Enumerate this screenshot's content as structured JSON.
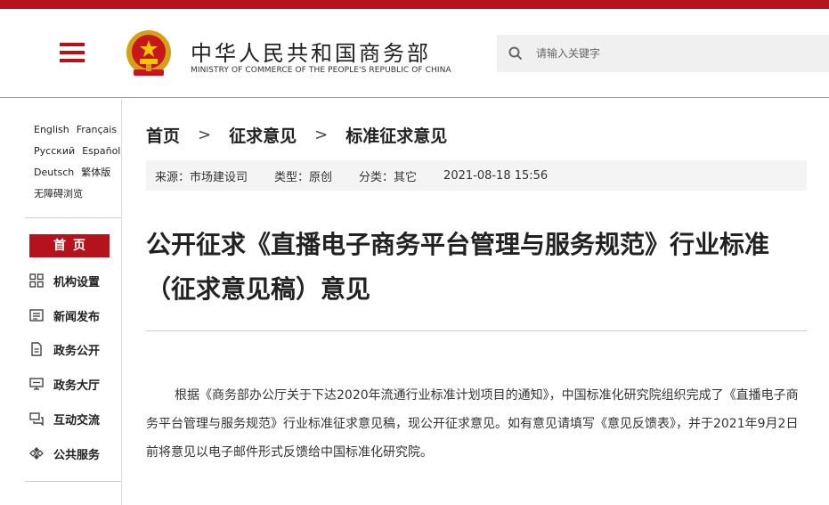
{
  "header": {
    "org_name_cn": "中华人民共和国商务部",
    "org_name_en": "MINISTRY OF COMMERCE OF THE PEOPLE'S REPUBLIC OF CHINA",
    "search_placeholder": "请输入关键字"
  },
  "sidebar": {
    "languages": [
      [
        "English",
        "Français"
      ],
      [
        "Русский",
        "Español"
      ],
      [
        "Deutsch",
        "繁体版"
      ],
      [
        "无障碍浏览"
      ]
    ],
    "home_label": "首页",
    "nav_items": [
      {
        "label": "机构设置",
        "icon": "grid-icon"
      },
      {
        "label": "新闻发布",
        "icon": "newspaper-icon"
      },
      {
        "label": "政务公开",
        "icon": "document-icon"
      },
      {
        "label": "政务大厅",
        "icon": "monitor-icon"
      },
      {
        "label": "互动交流",
        "icon": "chat-icon"
      },
      {
        "label": "公共服务",
        "icon": "service-icon"
      }
    ]
  },
  "breadcrumb": {
    "items": [
      "首页",
      "征求意见",
      "标准征求意见"
    ],
    "separator": ">"
  },
  "meta": {
    "source": "来源：市场建设司",
    "type": "类型：原创",
    "category": "分类：其它",
    "datetime": "2021-08-18 15:56"
  },
  "article": {
    "title": "公开征求《直播电子商务平台管理与服务规范》行业标准（征求意见稿）意见",
    "body": "根据《商务部办公厅关于下达2020年流通行业标准计划项目的通知》，中国标准化研究院组织完成了《直播电子商务平台管理与服务规范》行业标准征求意见稿，现公开征求意见。如有意见请填写《意见反馈表》，并于2021年9月2日前将意见以电子邮件形式反馈给中国标准化研究院。"
  },
  "colors": {
    "accent": "#b5121b",
    "meta_bg": "#f4f4f4",
    "search_bg": "#f0f0f0"
  }
}
